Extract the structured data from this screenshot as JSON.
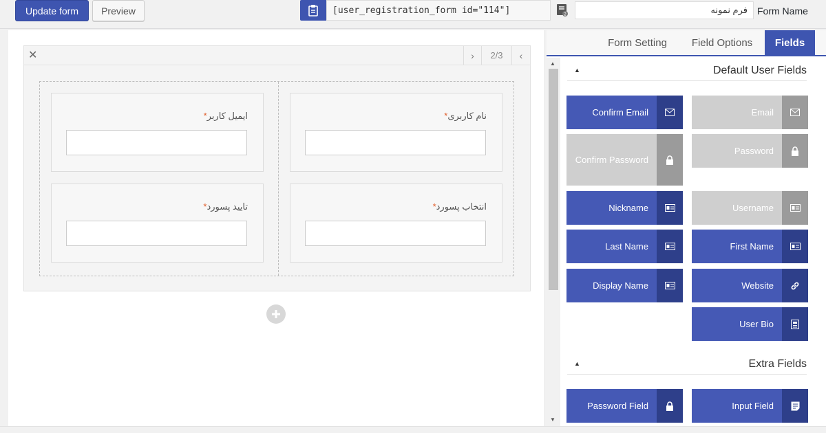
{
  "toolbar": {
    "update_label": "Update form",
    "preview_label": "Preview",
    "shortcode": "[user_registration_form id=\"114\"]",
    "form_name_label": "Form Name",
    "form_name_value": "فرم نمونه"
  },
  "builder": {
    "close_glyph": "✕",
    "pager_next_glyph": "›",
    "pager_prev_glyph": "‹",
    "pager_count": "2/3",
    "fields": [
      {
        "label": "نام کاربری",
        "required_mark": "*"
      },
      {
        "label": "ایمیل کاربر",
        "required_mark": "*"
      },
      {
        "label": "انتخاب پسورد",
        "required_mark": "*"
      },
      {
        "label": "تایید پسورد",
        "required_mark": "*"
      }
    ]
  },
  "side": {
    "tabs": [
      {
        "label": "Form Setting"
      },
      {
        "label": "Field Options"
      },
      {
        "label": "Fields"
      }
    ],
    "sections": [
      {
        "title": "Default User Fields",
        "caret": "▲"
      },
      {
        "title": "Extra Fields",
        "caret": "▲"
      }
    ],
    "default_fields": [
      {
        "label": "Confirm Email",
        "icon": "envelope-icon",
        "state": "enabled"
      },
      {
        "label": "Email",
        "icon": "envelope-icon",
        "state": "disabled"
      },
      {
        "label": "Confirm Password",
        "icon": "lock-icon",
        "state": "disabled"
      },
      {
        "label": "Password",
        "icon": "lock-icon",
        "state": "disabled"
      },
      {
        "label": "Nickname",
        "icon": "id-card-icon",
        "state": "enabled"
      },
      {
        "label": "Username",
        "icon": "id-card-icon",
        "state": "disabled"
      },
      {
        "label": "Last Name",
        "icon": "id-card-icon",
        "state": "enabled"
      },
      {
        "label": "First Name",
        "icon": "id-card-icon",
        "state": "enabled"
      },
      {
        "label": "Display Name",
        "icon": "id-card-icon",
        "state": "enabled"
      },
      {
        "label": "Website",
        "icon": "link-icon",
        "state": "enabled"
      },
      {
        "label": "User Bio",
        "icon": "profile-icon",
        "state": "enabled"
      }
    ],
    "extra_fields": [
      {
        "label": "Password Field",
        "icon": "lock-icon",
        "state": "enabled"
      },
      {
        "label": "Input Field",
        "icon": "text-lines-icon",
        "state": "enabled"
      }
    ]
  },
  "colors": {
    "accent": "#3e55b0",
    "button_enabled": "#4559b5",
    "button_enabled_icon": "#2e3f8a",
    "button_disabled": "#cfcfcf",
    "button_disabled_icon": "#9b9b9b",
    "required": "#e05e2c"
  }
}
